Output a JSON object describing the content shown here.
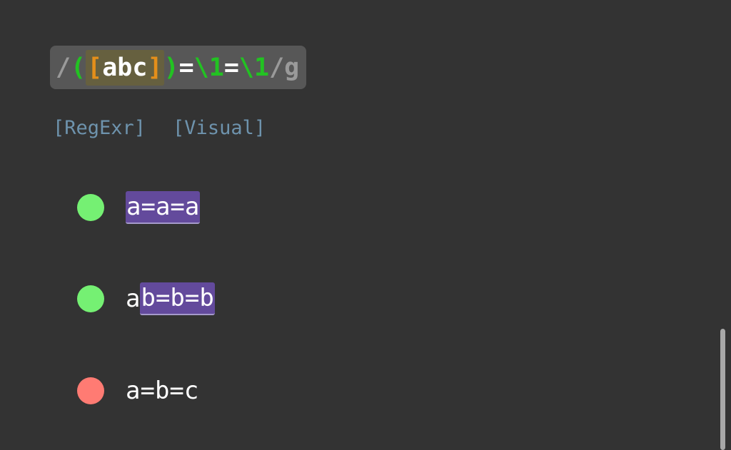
{
  "regex": {
    "open_delim": "/",
    "group_open": "(",
    "set_open": "[",
    "set_chars": "abc",
    "set_close": "]",
    "group_close": ")",
    "eq1": "=",
    "backref1": "\\1",
    "eq2": "=",
    "backref2": "\\1",
    "close_delim": "/",
    "flag": "g"
  },
  "links": {
    "regexr": "[RegExr]",
    "visual": "[Visual]"
  },
  "tests": [
    {
      "status": "match",
      "dot_color": "#75f073",
      "prefix": "",
      "match": "a=a=a",
      "suffix": ""
    },
    {
      "status": "match",
      "dot_color": "#75f073",
      "prefix": "a",
      "match": "b=b=b",
      "suffix": ""
    },
    {
      "status": "no-match",
      "dot_color": "#ff7b73",
      "prefix": "a=b=c",
      "match": "",
      "suffix": ""
    }
  ],
  "colors": {
    "background": "#333333",
    "regex_box": "#575757",
    "group": "#22c222",
    "bracket": "#e48f1a",
    "match_highlight": "#634a9c",
    "link": "#6e93ad"
  }
}
